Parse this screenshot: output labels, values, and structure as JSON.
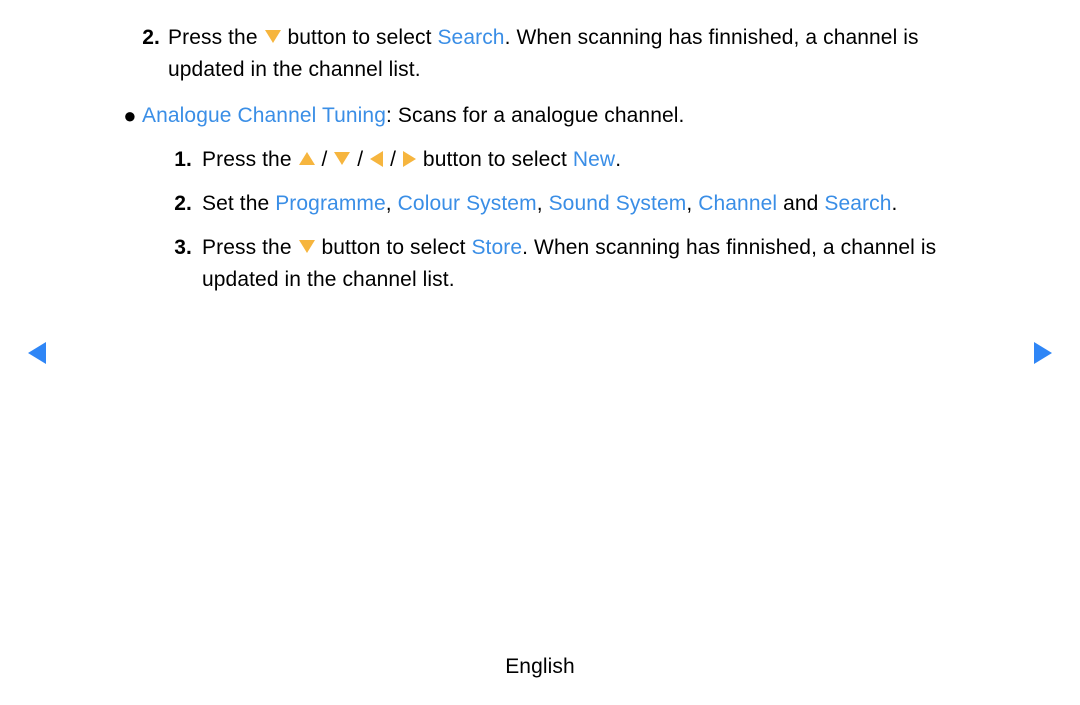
{
  "top_step2": {
    "num": "2.",
    "pre": "Press the ",
    "mid": " button to select ",
    "search": "Search",
    "post": ". When scanning has finnished, a channel is updated in the channel list."
  },
  "bullet": {
    "title": "Analogue Channel Tuning",
    "desc": ": Scans for a analogue channel."
  },
  "step1": {
    "num": "1.",
    "pre": "Press the ",
    "sep1": " / ",
    "sep2": " / ",
    "sep3": " / ",
    "mid": " button to select ",
    "new": "New",
    "dot": "."
  },
  "step2": {
    "num": "2.",
    "pre": "Set the ",
    "programme": "Programme",
    "c1": ", ",
    "colour": "Colour System",
    "c2": ", ",
    "sound": "Sound System",
    "c3": ", ",
    "channel": "Channel",
    "and": " and ",
    "search": "Search",
    "dot": "."
  },
  "step3": {
    "num": "3.",
    "pre": "Press the ",
    "mid": " button to select ",
    "store": "Store",
    "post": ". When scanning has finnished, a channel is updated in the channel list."
  },
  "footer": "English"
}
